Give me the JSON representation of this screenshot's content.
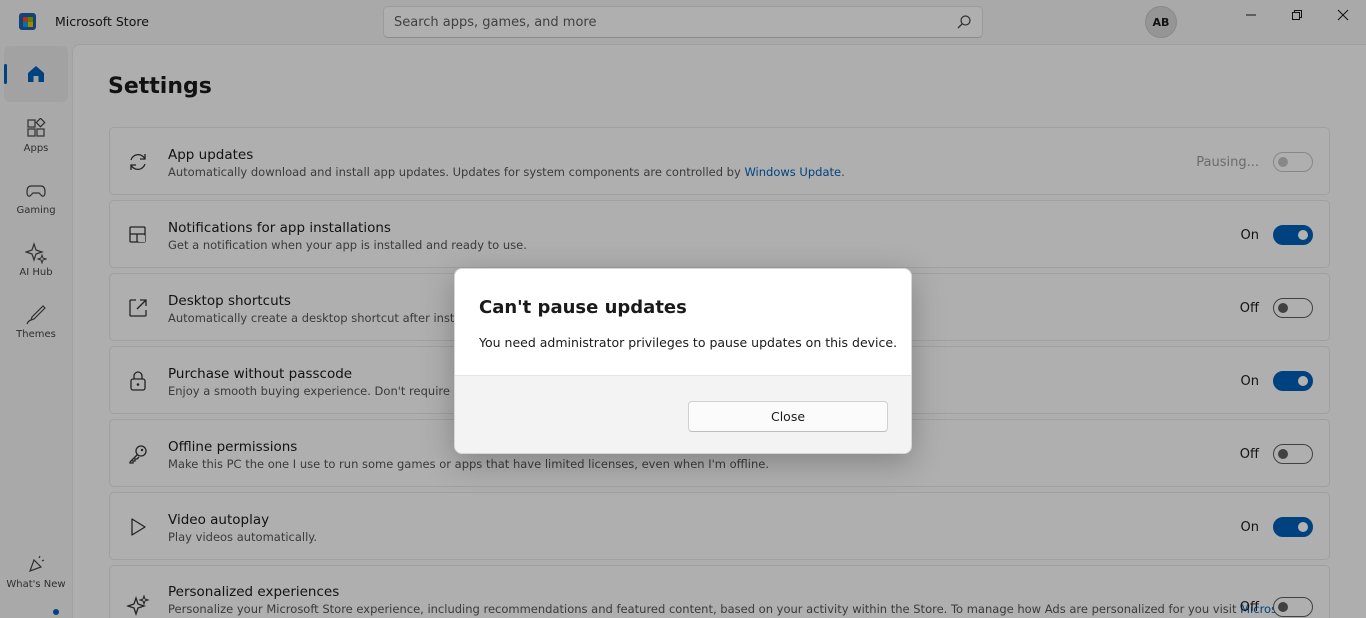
{
  "app": {
    "title": "Microsoft Store",
    "user_initials": "AB"
  },
  "search": {
    "placeholder": "Search apps, games, and more"
  },
  "nav": {
    "items": [
      {
        "label": "",
        "icon": "home-icon",
        "active": true
      },
      {
        "label": "Apps",
        "icon": "apps-icon"
      },
      {
        "label": "Gaming",
        "icon": "gaming-icon"
      },
      {
        "label": "AI Hub",
        "icon": "ai-hub-icon"
      },
      {
        "label": "Themes",
        "icon": "themes-icon"
      }
    ],
    "whats_new": "What's New"
  },
  "page": {
    "title": "Settings",
    "rows": [
      {
        "title": "App updates",
        "desc": "Automatically download and install app updates. Updates for system components are controlled by ",
        "link": "Windows Update",
        "desc_after": ".",
        "state": "Pausing...",
        "toggle": "disabled",
        "icon": "refresh-icon"
      },
      {
        "title": "Notifications for app installations",
        "desc": "Get a notification when your app is installed and ready to use.",
        "state": "On",
        "toggle": "on",
        "icon": "notification-icon"
      },
      {
        "title": "Desktop shortcuts",
        "desc": "Automatically create a desktop shortcut after installing",
        "state": "Off",
        "toggle": "off",
        "icon": "shortcut-icon"
      },
      {
        "title": "Purchase without passcode",
        "desc": "Enjoy a smooth buying experience. Don't require a PIN",
        "state": "On",
        "toggle": "on",
        "icon": "lock-icon"
      },
      {
        "title": "Offline permissions",
        "desc": "Make this PC the one I use to run some games or apps that have limited licenses, even when I'm offline.",
        "state": "Off",
        "toggle": "off",
        "icon": "key-icon"
      },
      {
        "title": "Video autoplay",
        "desc": "Play videos automatically.",
        "state": "On",
        "toggle": "on",
        "icon": "play-icon"
      },
      {
        "title": "Personalized experiences",
        "desc": "Personalize your Microsoft Store experience, including recommendations and featured content, based on your activity within the Store. To manage how Ads are personalized for you visit ",
        "link": "Microsoft",
        "state": "Off",
        "toggle": "off",
        "icon": "sparkle-icon"
      }
    ]
  },
  "dialog": {
    "title": "Can't pause updates",
    "message": "You need administrator privileges to pause updates on this device.",
    "close_label": "Close"
  },
  "colors": {
    "accent": "#005fb8",
    "overlay": "rgba(0,0,0,0.30)"
  }
}
